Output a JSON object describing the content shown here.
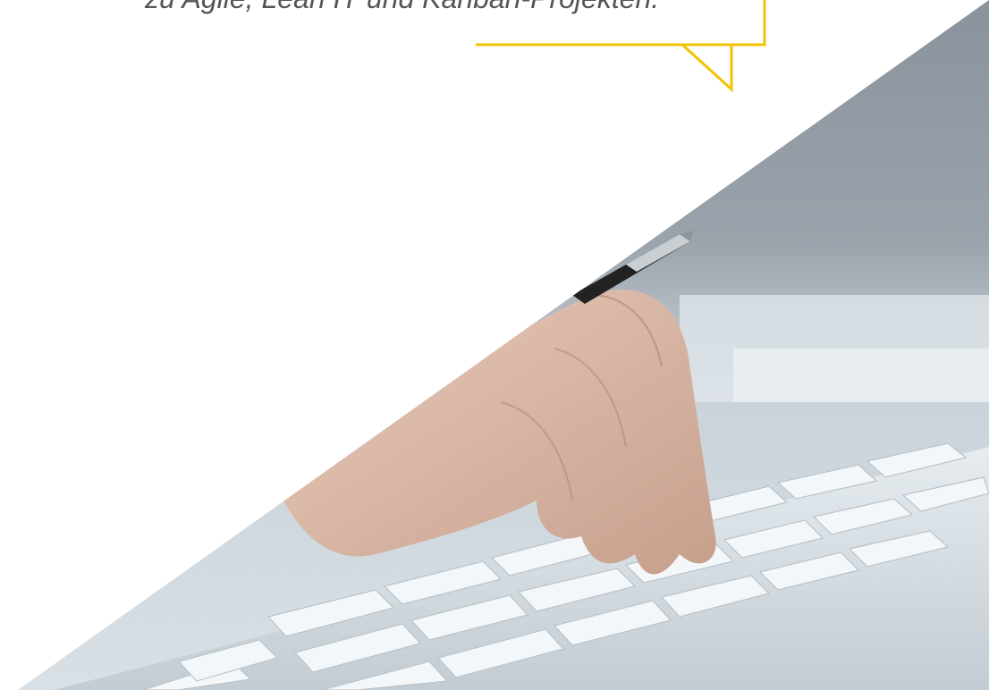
{
  "hero": {
    "tagline": "zu Agile, Lean IT und Kanban-Projekten."
  },
  "colors": {
    "accent": "#f2c300",
    "text": "#555555",
    "background": "#ffffff"
  },
  "image": {
    "subject": "hand-typing-on-keyboard-with-pen"
  }
}
